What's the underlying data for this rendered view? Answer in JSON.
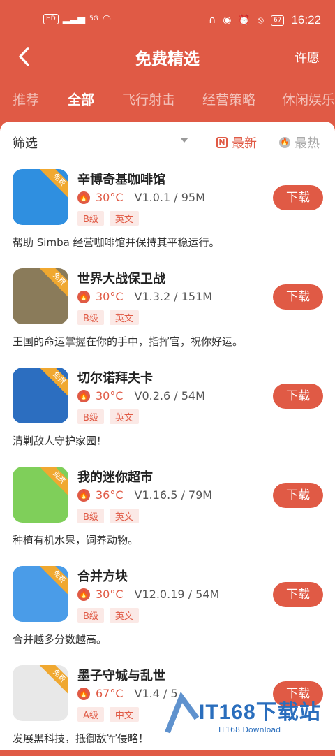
{
  "status": {
    "time": "16:22",
    "battery": "67",
    "hd": "HD",
    "net": "5G"
  },
  "header": {
    "title": "免费精选",
    "action": "许愿"
  },
  "tabs": [
    "推荐",
    "全部",
    "飞行射击",
    "经营策略",
    "休闲娱乐"
  ],
  "active_tab": "全部",
  "filter": {
    "label": "筛选",
    "sort_new": "最新",
    "sort_hot": "最热",
    "new_icon": "N"
  },
  "ribbon_label": "免费",
  "download_label": "下载",
  "apps": [
    {
      "name": "辛博奇基咖啡馆",
      "temp": "30°C",
      "version": "V1.0.1 / 95M",
      "grade": "B级",
      "lang": "英文",
      "desc": "帮助 Simba 经营咖啡馆并保持其平稳运行。",
      "bg": "#2f8fe0"
    },
    {
      "name": "世界大战保卫战",
      "temp": "30°C",
      "version": "V1.3.2 / 151M",
      "grade": "B级",
      "lang": "英文",
      "desc": "王国的命运掌握在你的手中，指挥官，祝你好运。",
      "bg": "#8a7b5a"
    },
    {
      "name": "切尔诺拜夫卡",
      "temp": "30°C",
      "version": "V0.2.6 / 54M",
      "grade": "B级",
      "lang": "英文",
      "desc": "清剿敌人守护家园！",
      "bg": "#2c6ec0"
    },
    {
      "name": "我的迷你超市",
      "temp": "36°C",
      "version": "V1.16.5 / 79M",
      "grade": "B级",
      "lang": "英文",
      "desc": "种植有机水果，饲养动物。",
      "bg": "#7fcf5a"
    },
    {
      "name": "合并方块",
      "temp": "30°C",
      "version": "V12.0.19 / 54M",
      "grade": "B级",
      "lang": "英文",
      "desc": "合并越多分数越高。",
      "bg": "#4a9ce8"
    },
    {
      "name": "墨子守城与乱世",
      "temp": "67°C",
      "version": "V1.4 / 5",
      "grade": "A级",
      "lang": "中文",
      "desc": "发展黑科技，抵御敌军侵略！",
      "bg": "#e8e8e8"
    }
  ],
  "watermark": {
    "main": "IT168下载站",
    "sub": "IT168 Download"
  }
}
